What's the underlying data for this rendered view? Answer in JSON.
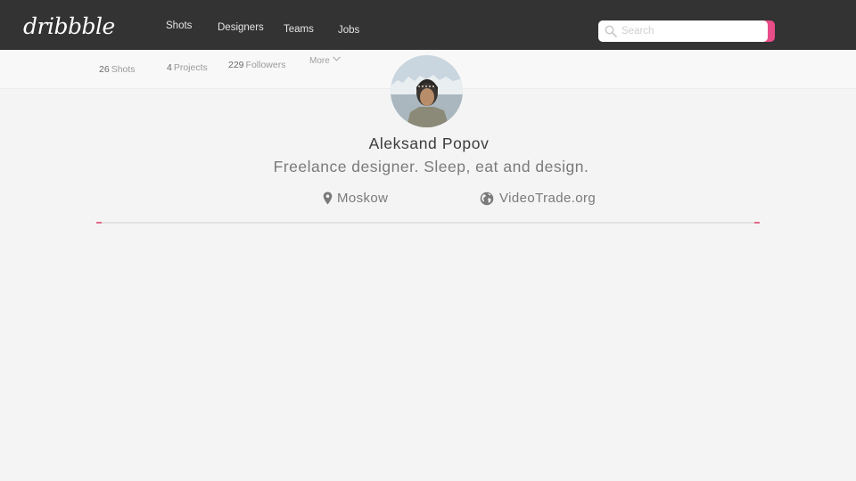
{
  "header": {
    "logo": "dribbble",
    "nav": [
      {
        "label": "Shots"
      },
      {
        "label": "Designers"
      },
      {
        "label": "Teams"
      },
      {
        "label": "Jobs"
      }
    ],
    "search": {
      "placeholder": "Search",
      "value": "",
      "icon": "search-icon"
    },
    "accent_color": "#e84c89"
  },
  "profile_nav": {
    "stats": [
      {
        "count": "26",
        "label": "Shots"
      },
      {
        "count": "4",
        "label": "Projects"
      },
      {
        "count": "229",
        "label": "Followers"
      }
    ],
    "more_label": "More",
    "more_icon": "chevron-down-icon"
  },
  "profile": {
    "name": "Aleksand Popov",
    "bio": "Freelance designer. Sleep, eat and design.",
    "location": {
      "icon": "map-pin-icon",
      "text": "Moskow"
    },
    "website": {
      "icon": "globe-icon",
      "text": "VideoTrade.org"
    }
  }
}
